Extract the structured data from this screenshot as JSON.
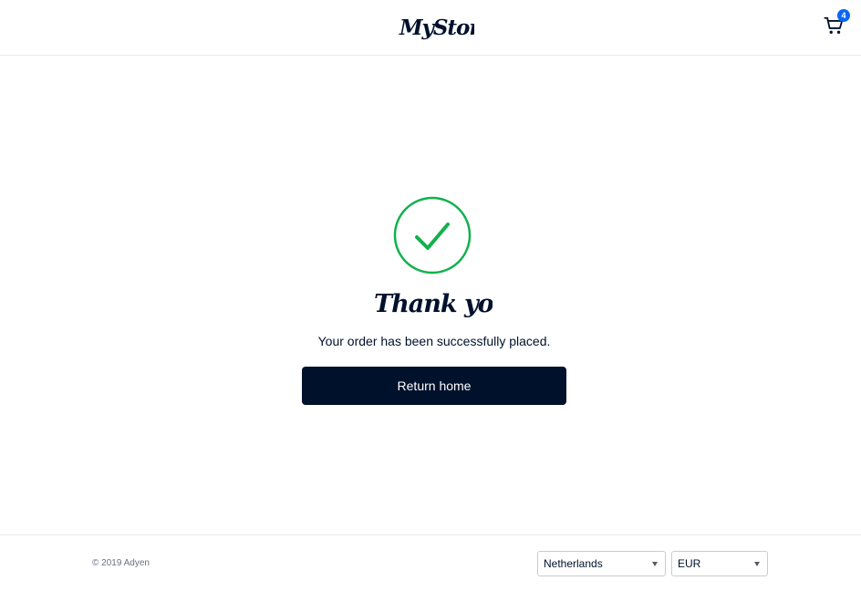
{
  "header": {
    "logo_text": "MyStore.",
    "cart_count": "4"
  },
  "main": {
    "heading": "Thank you!",
    "message": "Your order has been successfully placed.",
    "return_label": "Return home"
  },
  "footer": {
    "copyright": "© 2019 Adyen",
    "country": "Netherlands",
    "currency": "EUR"
  },
  "colors": {
    "primary": "#00112c",
    "success": "#12b14d",
    "badge": "#0a66f2",
    "border": "#e6e9eb"
  },
  "icons": {
    "cart": "cart-icon",
    "success": "checkmark-circle-icon",
    "caret": "caret-down-icon"
  }
}
